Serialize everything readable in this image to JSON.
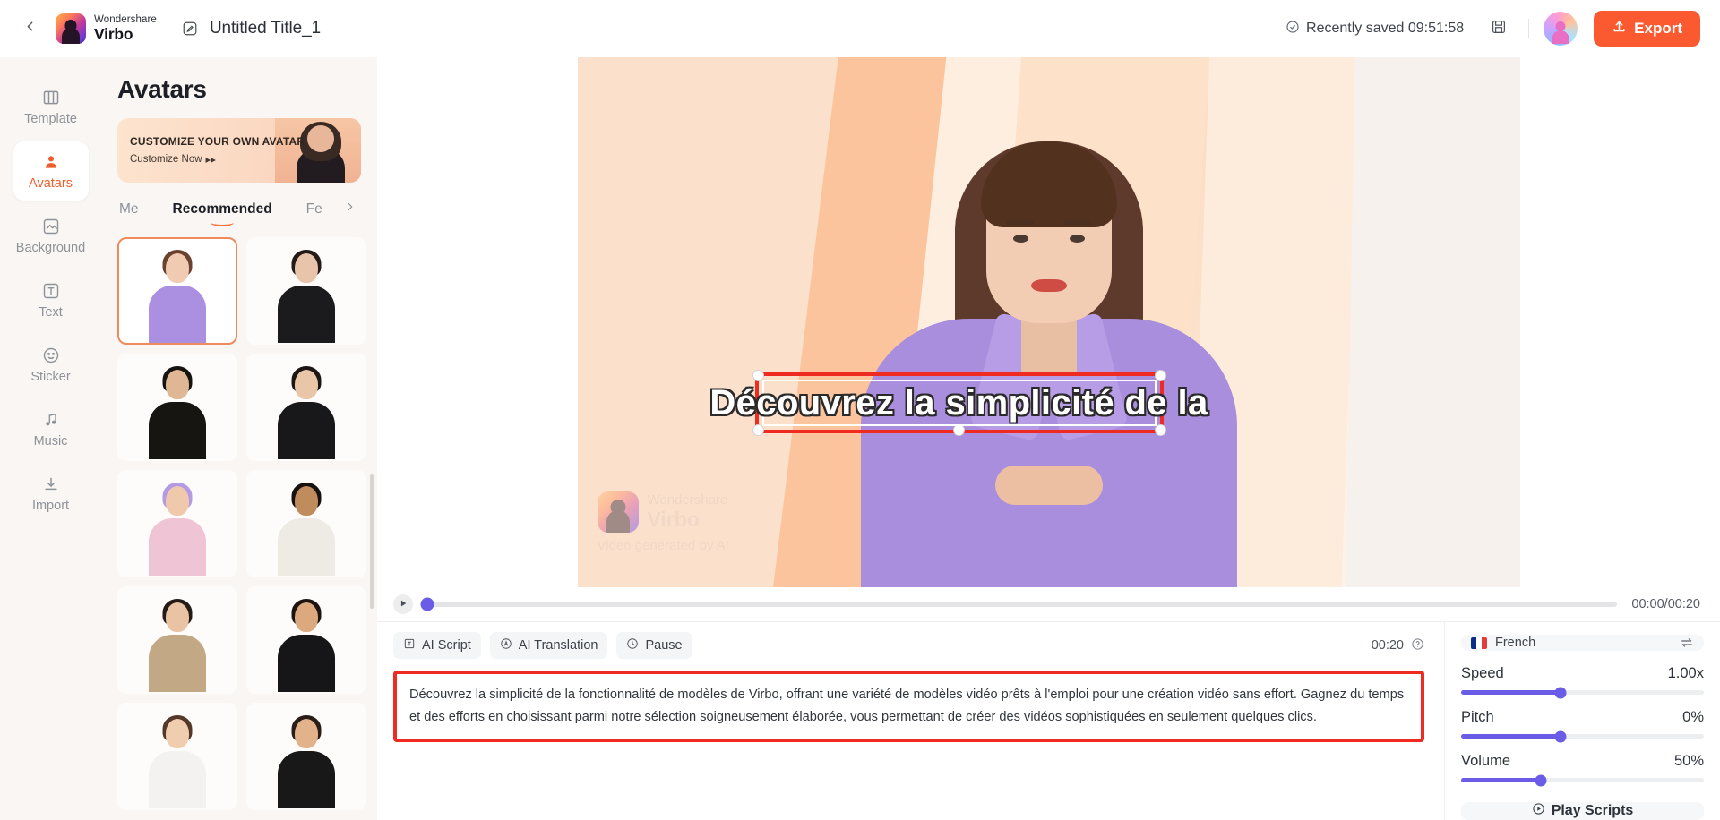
{
  "topbar": {
    "back_icon": "chevron-left-icon",
    "brand_top": "Wondershare",
    "brand_bottom": "Virbo",
    "edit_icon": "edit-pencil-icon",
    "doc_title": "Untitled Title_1",
    "saved_status": "Recently saved 09:51:58",
    "saved_icon": "check-circle-icon",
    "save_icon": "floppy-save-icon",
    "avatar_icon": "user-avatar",
    "export_label": "Export",
    "export_icon": "upload-icon",
    "export_color": "#fb5a31"
  },
  "rail": {
    "items": [
      {
        "label": "Template",
        "icon": "template-icon",
        "active": false
      },
      {
        "label": "Avatars",
        "icon": "avatar-person-icon",
        "active": true
      },
      {
        "label": "Background",
        "icon": "background-icon",
        "active": false
      },
      {
        "label": "Text",
        "icon": "text-icon",
        "active": false
      },
      {
        "label": "Sticker",
        "icon": "sticker-smiley-icon",
        "active": false
      },
      {
        "label": "Music",
        "icon": "music-note-icon",
        "active": false
      },
      {
        "label": "Import",
        "icon": "import-download-icon",
        "active": false
      }
    ]
  },
  "panel": {
    "title": "Avatars",
    "promo": {
      "headline": "CUSTOMIZE YOUR OWN AVATAR",
      "cta": "Customize Now",
      "cta_arrow": "▸▸"
    },
    "tabs": [
      {
        "label": "Me",
        "active": false
      },
      {
        "label": "Recommended",
        "active": true
      },
      {
        "label": "Fe",
        "active": false
      }
    ],
    "tab_next_icon": "chevron-right-icon",
    "avatars": [
      {
        "name": "avatar-purple-blazer-woman",
        "selected": true,
        "skin": "#f0cbb1",
        "hair": "#6b4230",
        "outfit": "#ab8fe0"
      },
      {
        "name": "avatar-black-suit-woman",
        "selected": false,
        "skin": "#e8c4ab",
        "hair": "#241a17",
        "outfit": "#1b1b1d"
      },
      {
        "name": "avatar-hijab-woman",
        "selected": false,
        "skin": "#e0b795",
        "hair": "#15140f",
        "outfit": "#161512"
      },
      {
        "name": "avatar-one-shoulder-woman",
        "selected": false,
        "skin": "#eac6a8",
        "hair": "#1d1714",
        "outfit": "#18181a"
      },
      {
        "name": "avatar-beret-pink-woman",
        "selected": false,
        "skin": "#f0c9ac",
        "hair": "#4a3225",
        "outfit": "#efc4d4"
      },
      {
        "name": "avatar-white-shirt-man",
        "selected": false,
        "skin": "#c08c5e",
        "hair": "#17120f",
        "outfit": "#eeeae4"
      },
      {
        "name": "avatar-houndstooth-woman",
        "selected": false,
        "skin": "#e9c3a4",
        "hair": "#251b16",
        "outfit": "#c3a886"
      },
      {
        "name": "avatar-black-tank-woman",
        "selected": false,
        "skin": "#dca97f",
        "hair": "#1b1411",
        "outfit": "#161618"
      },
      {
        "name": "avatar-white-blouse-woman",
        "selected": false,
        "skin": "#f1cdb0",
        "hair": "#54392a",
        "outfit": "#f3f2f0"
      },
      {
        "name": "avatar-black-tank-man",
        "selected": false,
        "skin": "#e2b28a",
        "hair": "#2a1d16",
        "outfit": "#181819"
      }
    ]
  },
  "video": {
    "subtitle_text": "Découvrez la simplicité de la",
    "watermark_top": "Wondershare",
    "watermark_bottom": "Virbo",
    "watermark_sub": "Video generated by AI",
    "selection_color": "#ee2a21"
  },
  "player": {
    "play_icon": "play-icon",
    "time_label": "00:00/00:20",
    "progress_percent": 0
  },
  "script": {
    "tools": [
      {
        "label": "AI Script",
        "icon": "text-box-icon"
      },
      {
        "label": "AI Translation",
        "icon": "translate-circle-icon"
      },
      {
        "label": "Pause",
        "icon": "clock-pause-icon"
      }
    ],
    "duration": "00:20",
    "help_icon": "help-circle-icon",
    "body": "Découvrez la simplicité de la fonctionnalité de modèles de Virbo, offrant une variété de modèles vidéo prêts à l'emploi pour une création vidéo sans effort. Gagnez du temps et des efforts en choisissant parmi notre sélection soigneusement élaborée, vous permettant de créer des vidéos sophistiquées en seulement quelques clics."
  },
  "voice": {
    "language": "French",
    "flag_icon": "french-flag-icon",
    "swap_icon": "swap-arrows-icon",
    "controls": [
      {
        "label": "Speed",
        "value": "1.00x",
        "percent": 41
      },
      {
        "label": "Pitch",
        "value": "0%",
        "percent": 41
      },
      {
        "label": "Volume",
        "value": "50%",
        "percent": 33
      }
    ],
    "accent_color": "#6b5ce7",
    "play_scripts_label": "Play Scripts",
    "play_scripts_icon": "play-circle-icon"
  }
}
